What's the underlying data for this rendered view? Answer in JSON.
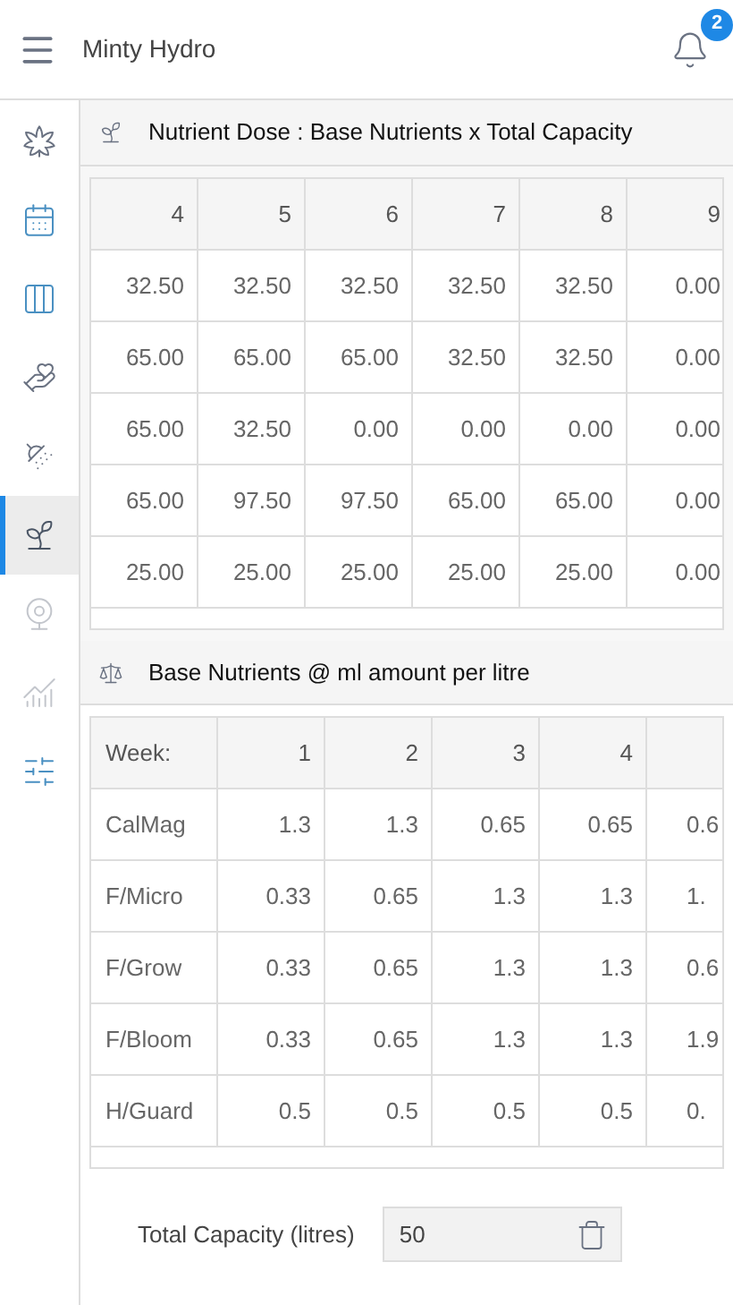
{
  "app_bar": {
    "title": "Minty Hydro",
    "notifications": "2"
  },
  "sidebar": {
    "items": [
      {
        "selected": false,
        "disabled": false
      },
      {
        "selected": false,
        "disabled": false
      },
      {
        "selected": false,
        "disabled": false
      },
      {
        "selected": false,
        "disabled": false
      },
      {
        "selected": false,
        "disabled": false
      },
      {
        "selected": true,
        "disabled": false
      },
      {
        "selected": false,
        "disabled": true
      },
      {
        "selected": false,
        "disabled": true
      },
      {
        "selected": false,
        "disabled": false
      }
    ]
  },
  "dose_section": {
    "title": "Nutrient Dose : Base Nutrients x Total Capacity",
    "columns": [
      "4",
      "5",
      "6",
      "7",
      "8",
      "9"
    ],
    "rows": [
      [
        "32.50",
        "32.50",
        "32.50",
        "32.50",
        "32.50",
        "0.00"
      ],
      [
        "65.00",
        "65.00",
        "65.00",
        "32.50",
        "32.50",
        "0.00"
      ],
      [
        "65.00",
        "32.50",
        "0.00",
        "0.00",
        "0.00",
        "0.00"
      ],
      [
        "65.00",
        "97.50",
        "97.50",
        "65.00",
        "65.00",
        "0.00"
      ],
      [
        "25.00",
        "25.00",
        "25.00",
        "25.00",
        "25.00",
        "0.00"
      ]
    ]
  },
  "base_section": {
    "title": "Base Nutrients @ ml amount per litre",
    "columns": [
      "Week:",
      "1",
      "2",
      "3",
      "4"
    ],
    "rows": [
      {
        "name": "CalMag",
        "values": [
          "1.3",
          "1.3",
          "0.65",
          "0.65",
          "0.6"
        ]
      },
      {
        "name": "F/Micro",
        "values": [
          "0.33",
          "0.65",
          "1.3",
          "1.3",
          "1."
        ]
      },
      {
        "name": "F/Grow",
        "values": [
          "0.33",
          "0.65",
          "1.3",
          "1.3",
          "0.6"
        ]
      },
      {
        "name": "F/Bloom",
        "values": [
          "0.33",
          "0.65",
          "1.3",
          "1.3",
          "1.9"
        ]
      },
      {
        "name": "H/Guard",
        "values": [
          "0.5",
          "0.5",
          "0.5",
          "0.5",
          "0."
        ]
      }
    ]
  },
  "capacity": {
    "label": "Total Capacity (litres)",
    "value": "50"
  }
}
